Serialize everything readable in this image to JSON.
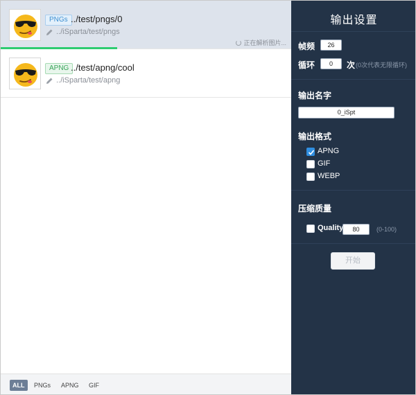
{
  "files": [
    {
      "tag": "PNGs",
      "title": "../test/pngs/0",
      "path": "../iSparta/test/pngs",
      "status": "正在解析图片...",
      "progress": 0.4,
      "selected": true
    },
    {
      "tag": "APNG",
      "title": "../test/apng/cool",
      "path": "../iSparta/test/apng",
      "selected": false
    }
  ],
  "filters": [
    "ALL",
    "PNGs",
    "APNG",
    "GIF"
  ],
  "active_filter": "ALL",
  "settings": {
    "title": "输出设置",
    "fps_label": "帧频",
    "fps_value": "26",
    "loop_label": "循环",
    "loop_value": "0",
    "loop_unit": "次",
    "loop_hint": "(0次代表无限循环)",
    "name_label": "输出名字",
    "name_value": "0_iSpt",
    "format_label": "输出格式",
    "formats": [
      {
        "label": "APNG",
        "checked": true
      },
      {
        "label": "GIF",
        "checked": false
      },
      {
        "label": "WEBP",
        "checked": false
      }
    ],
    "quality_section_label": "压缩质量",
    "quality_label": "Quality",
    "quality_value": "80",
    "quality_hint": "(0-100)",
    "quality_checked": false,
    "start_label": "开始"
  },
  "colors": {
    "panel_bg": "#233347",
    "selected_bg": "#dde3ec",
    "progress": "#2ecc71",
    "checkbox_checked": "#2f8ee0"
  },
  "icons": {
    "thumbnail": "emoji-sunglasses-face",
    "path": "pencil-icon",
    "status": "spinner-icon",
    "check": "checkmark-icon"
  }
}
